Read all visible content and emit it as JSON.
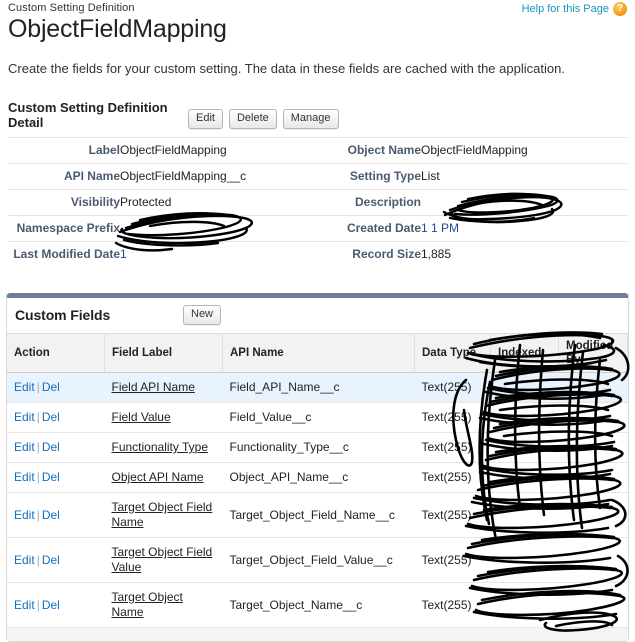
{
  "header": {
    "breadcrumb": "Custom Setting Definition",
    "title": "ObjectFieldMapping",
    "help_label": "Help for this Page",
    "help_icon": "help-question-icon",
    "intro": "Create the fields for your custom setting. The data in these fields are cached with the application."
  },
  "detail": {
    "title": "Custom Setting Definition Detail",
    "buttons": {
      "edit": "Edit",
      "delete": "Delete",
      "manage": "Manage"
    },
    "rows": [
      {
        "left_label": "Label",
        "left_value": "ObjectFieldMapping",
        "right_label": "Object Name",
        "right_value": "ObjectFieldMapping"
      },
      {
        "left_label": "API Name",
        "left_value": "ObjectFieldMapping__c",
        "right_label": "Setting Type",
        "right_value": "List"
      },
      {
        "left_label": "Visibility",
        "left_value": "Protected",
        "right_label": "Description",
        "right_value": ""
      },
      {
        "left_label": "Namespace Prefix",
        "left_value": "",
        "right_label": "Created Date",
        "right_value": "1                            1 PM"
      },
      {
        "left_label": "Last Modified Date",
        "left_value": "1",
        "right_label": "Record Size",
        "right_value": "1,885"
      }
    ]
  },
  "custom_fields": {
    "title": "Custom Fields",
    "new_button": "New",
    "columns": [
      "Action",
      "Field Label",
      "API Name",
      "Data Type",
      "Indexed",
      "Modified By"
    ],
    "action_edit": "Edit",
    "action_sep": "|",
    "action_del": "Del",
    "rows": [
      {
        "field_label": "Field API Name",
        "api_name": "Field_API_Name__c",
        "data_type": "Text(255)",
        "indexed": "",
        "modified_by": ""
      },
      {
        "field_label": "Field Value",
        "api_name": "Field_Value__c",
        "data_type": "Text(255)",
        "indexed": "",
        "modified_by": ""
      },
      {
        "field_label": "Functionality Type",
        "api_name": "Functionality_Type__c",
        "data_type": "Text(255)",
        "indexed": "",
        "modified_by": ""
      },
      {
        "field_label": "Object API Name",
        "api_name": "Object_API_Name__c",
        "data_type": "Text(255)",
        "indexed": "",
        "modified_by": ""
      },
      {
        "field_label": "Target Object Field Name",
        "api_name": "Target_Object_Field_Name__c",
        "data_type": "Text(255)",
        "indexed": "",
        "modified_by": ""
      },
      {
        "field_label": "Target Object Field Value",
        "api_name": "Target_Object_Field_Value__c",
        "data_type": "Text(255)",
        "indexed": "",
        "modified_by": ""
      },
      {
        "field_label": "Target Object Name",
        "api_name": "Target_Object_Name__c",
        "data_type": "Text(255)",
        "indexed": "",
        "modified_by": ""
      }
    ]
  },
  "colors": {
    "link": "#1270c0",
    "help_link": "#1797c0",
    "label": "#4a5a70",
    "panel_bar": "#6f7c9b",
    "row_highlight": "#e8f3fd",
    "redaction": "#000000"
  }
}
